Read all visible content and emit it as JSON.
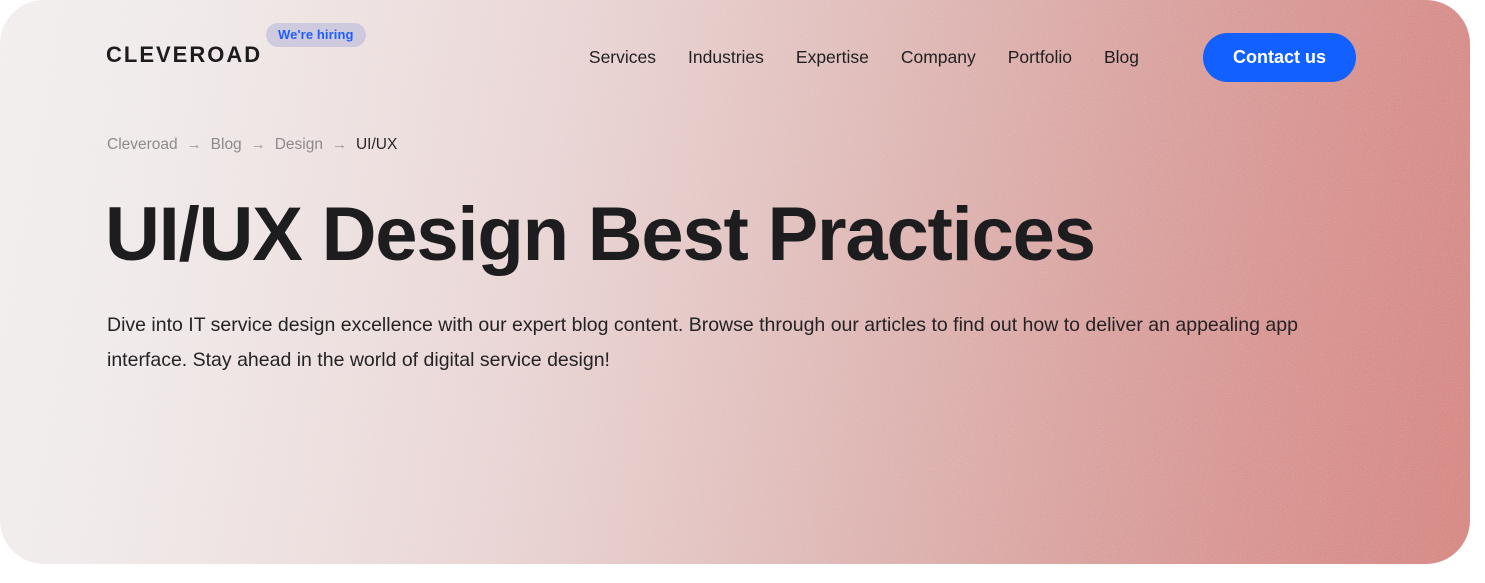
{
  "brand": {
    "name": "CLEVEROAD",
    "badge": "We're hiring"
  },
  "nav": {
    "items": [
      {
        "label": "Services"
      },
      {
        "label": "Industries"
      },
      {
        "label": "Expertise"
      },
      {
        "label": "Company"
      },
      {
        "label": "Portfolio"
      },
      {
        "label": "Blog"
      }
    ],
    "cta": "Contact us"
  },
  "breadcrumb": {
    "separator": "→",
    "items": [
      {
        "label": "Cleveroad",
        "current": false
      },
      {
        "label": "Blog",
        "current": false
      },
      {
        "label": "Design",
        "current": false
      },
      {
        "label": "UI/UX",
        "current": true
      }
    ]
  },
  "hero": {
    "title": "UI/UX Design Best Practices",
    "subtitle": "Dive into IT service design excellence with our expert blog content. Browse through our articles to find out how to deliver an appealing app interface. Stay ahead in the world of digital service design!"
  },
  "colors": {
    "accent_blue": "#1160ff",
    "badge_text": "#1f5dfa",
    "text_dark": "#1d1d1f",
    "breadcrumb_muted": "#8e8a8c",
    "gradient_start": "#f2eeee",
    "gradient_end": "#d4827e"
  }
}
